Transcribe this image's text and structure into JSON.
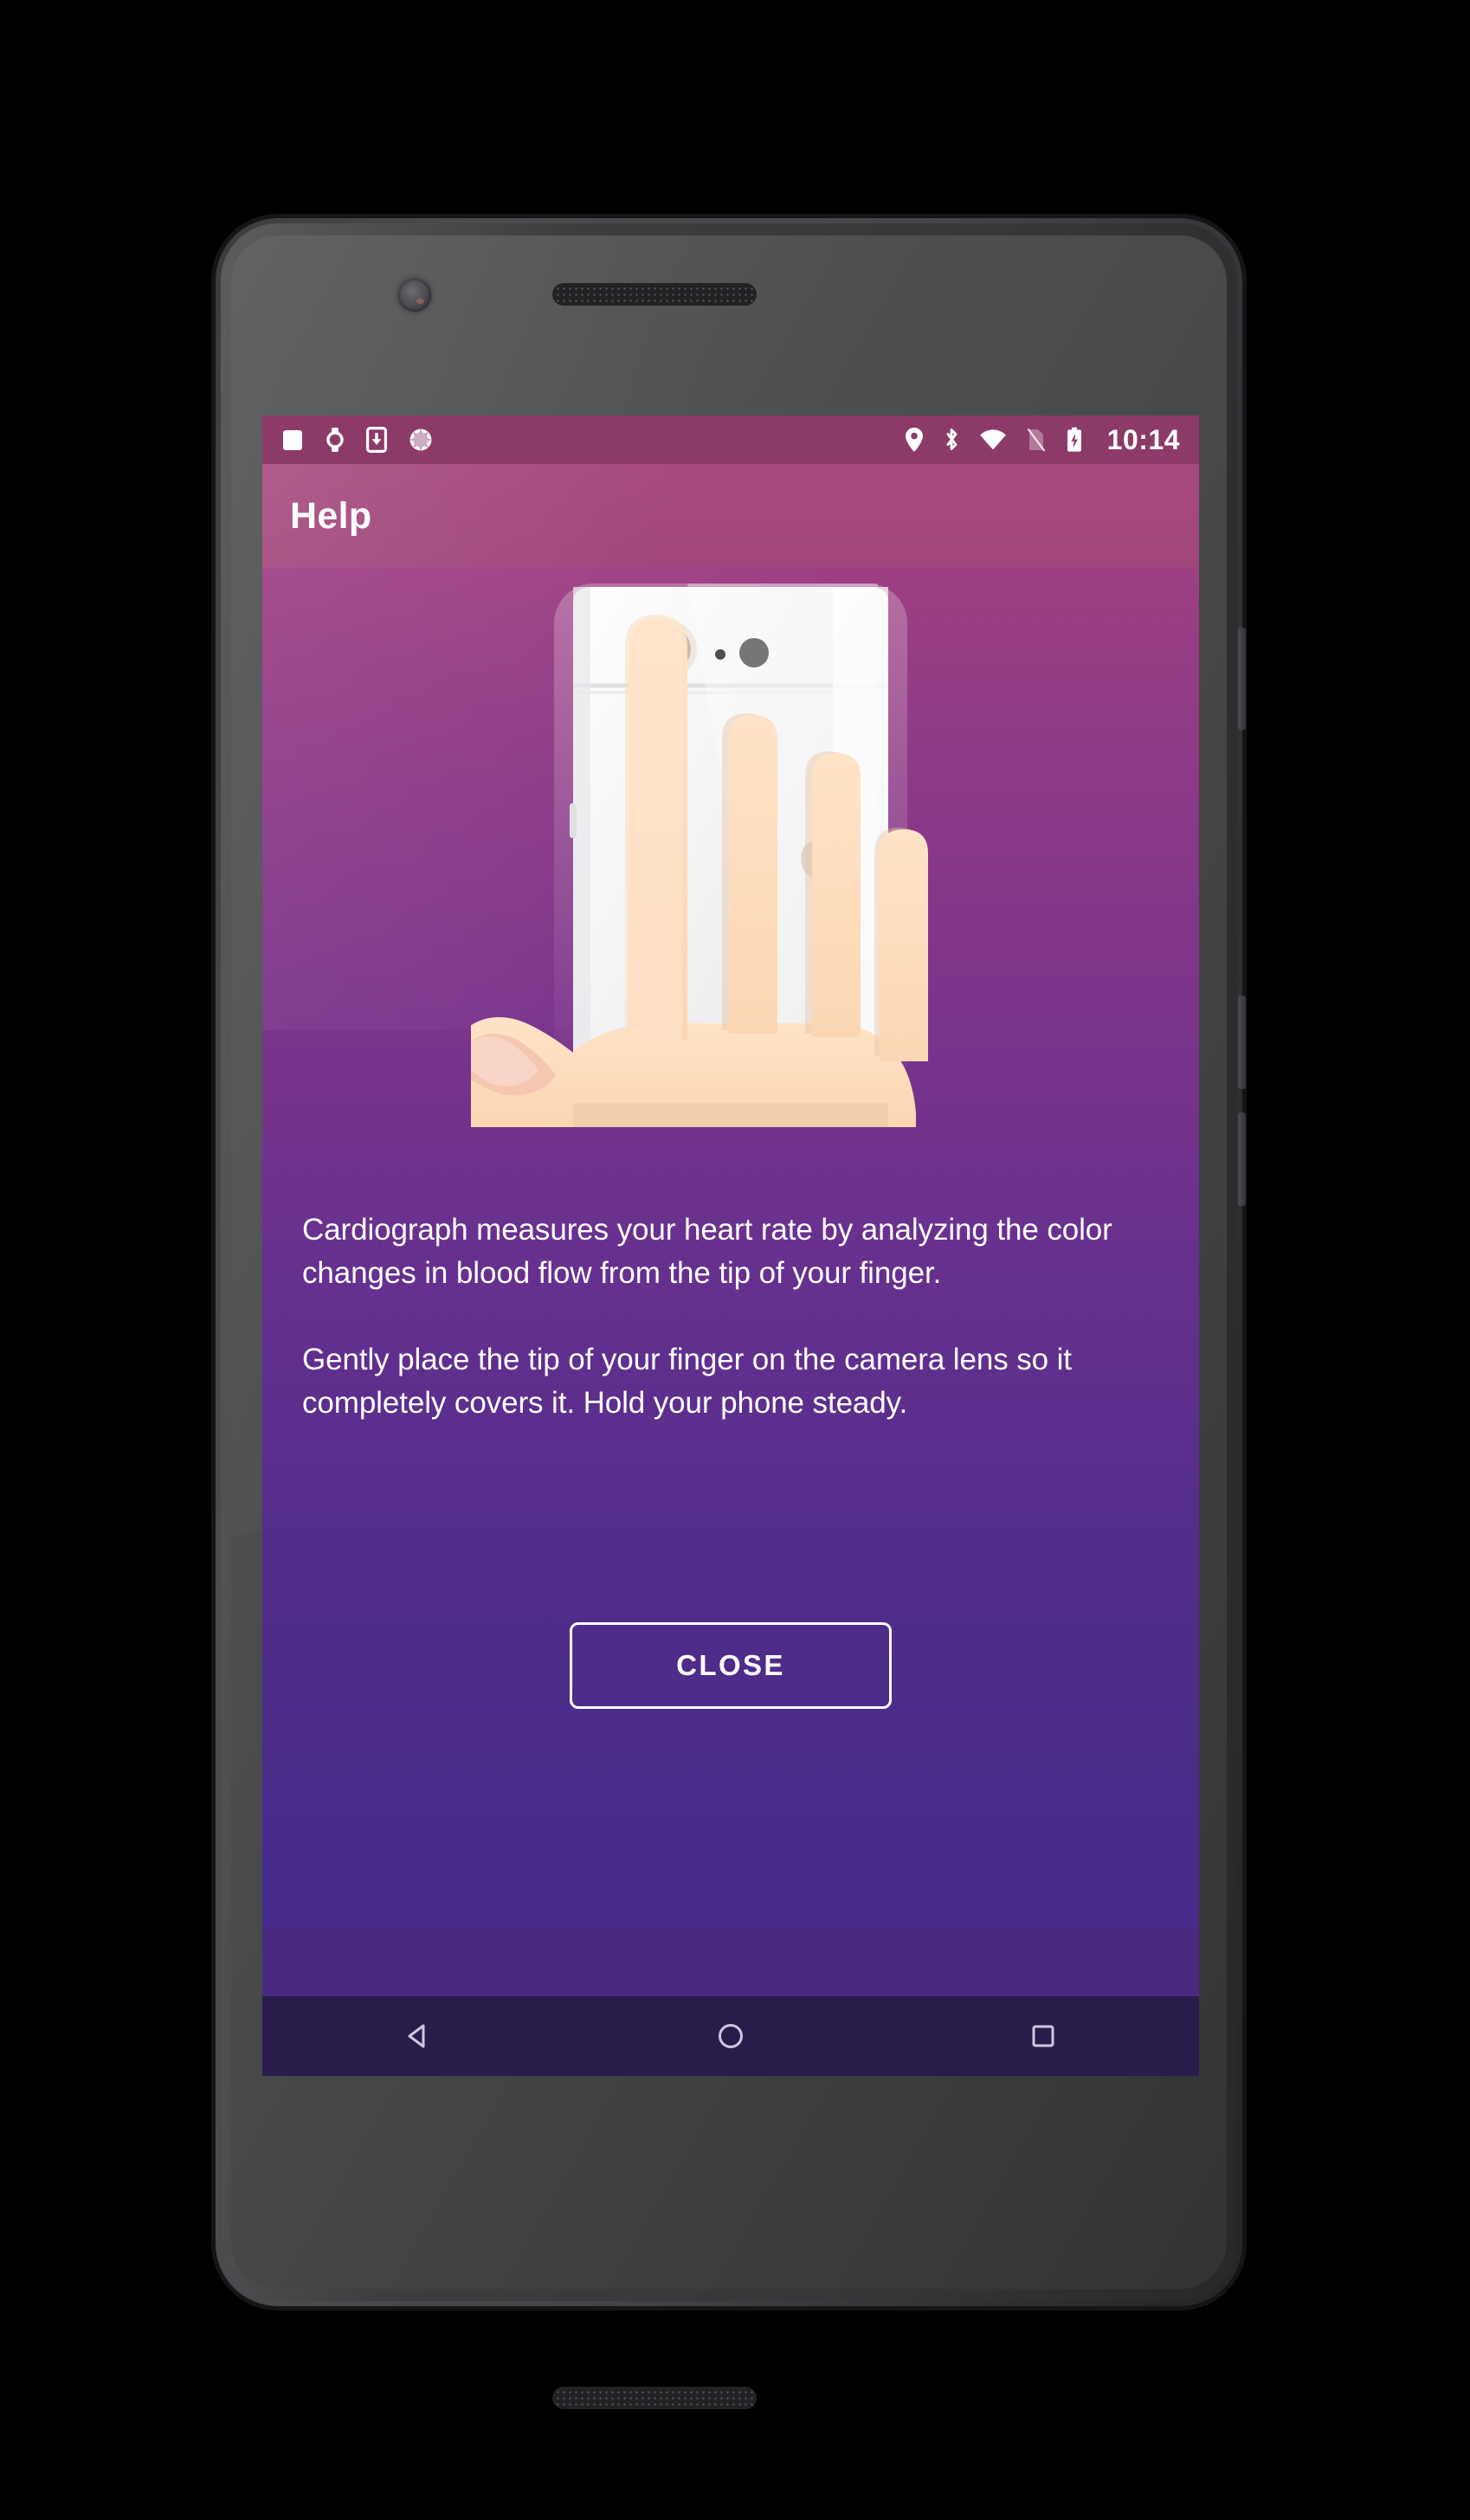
{
  "device": {
    "kind": "android-phone-mockup",
    "front_camera": "front-camera",
    "earpiece": "earpiece-speaker",
    "bottom_speaker": "bottom-speaker",
    "buttons": [
      "power-button",
      "volume-up-button",
      "volume-down-button"
    ]
  },
  "status_bar": {
    "background_color": "#8c3a68",
    "time": "10:14",
    "left_icons": [
      {
        "name": "screenshot-icon",
        "glyph": "square"
      },
      {
        "name": "watch-icon",
        "glyph": "watch"
      },
      {
        "name": "download-to-device-icon",
        "glyph": "phone-download"
      },
      {
        "name": "sync-spinner-icon",
        "glyph": "sunburst-circle"
      }
    ],
    "right_icons": [
      {
        "name": "location-icon",
        "glyph": "map-pin"
      },
      {
        "name": "bluetooth-icon",
        "glyph": "bluetooth"
      },
      {
        "name": "wifi-icon",
        "glyph": "wifi-full"
      },
      {
        "name": "no-sim-icon",
        "glyph": "signal-off"
      },
      {
        "name": "battery-charging-icon",
        "glyph": "battery-bolt"
      }
    ]
  },
  "app_bar": {
    "title": "Help",
    "background_color": "#a6497f",
    "title_color": "#ffffff"
  },
  "content": {
    "gradient_top_color": "#9e3f84",
    "gradient_bottom_color": "#472c8b",
    "illustration": {
      "name": "finger-on-camera-illustration",
      "description": "White smartphone back with camera lens, microphone and flash, index finger of a hand covering the camera lens",
      "phone_body_color": "#f4f4f5",
      "skin_color": "#fcdcbd",
      "lens_color": "#c9bcb0",
      "flash_color": "#767676"
    },
    "paragraphs": [
      "Cardiograph measures your heart rate by analyzing the color changes in blood flow from the tip of your finger.",
      "Gently place the tip of your finger on the camera lens so it completely covers it. Hold your phone steady."
    ],
    "close_button": {
      "label": "CLOSE",
      "border_color": "#ffffff",
      "text_color": "#ffffff"
    }
  },
  "nav_bar": {
    "background_color": "#2a1c4a",
    "buttons": [
      {
        "name": "nav-back-button",
        "glyph": "triangle-left"
      },
      {
        "name": "nav-home-button",
        "glyph": "circle"
      },
      {
        "name": "nav-recents-button",
        "glyph": "square"
      }
    ]
  }
}
